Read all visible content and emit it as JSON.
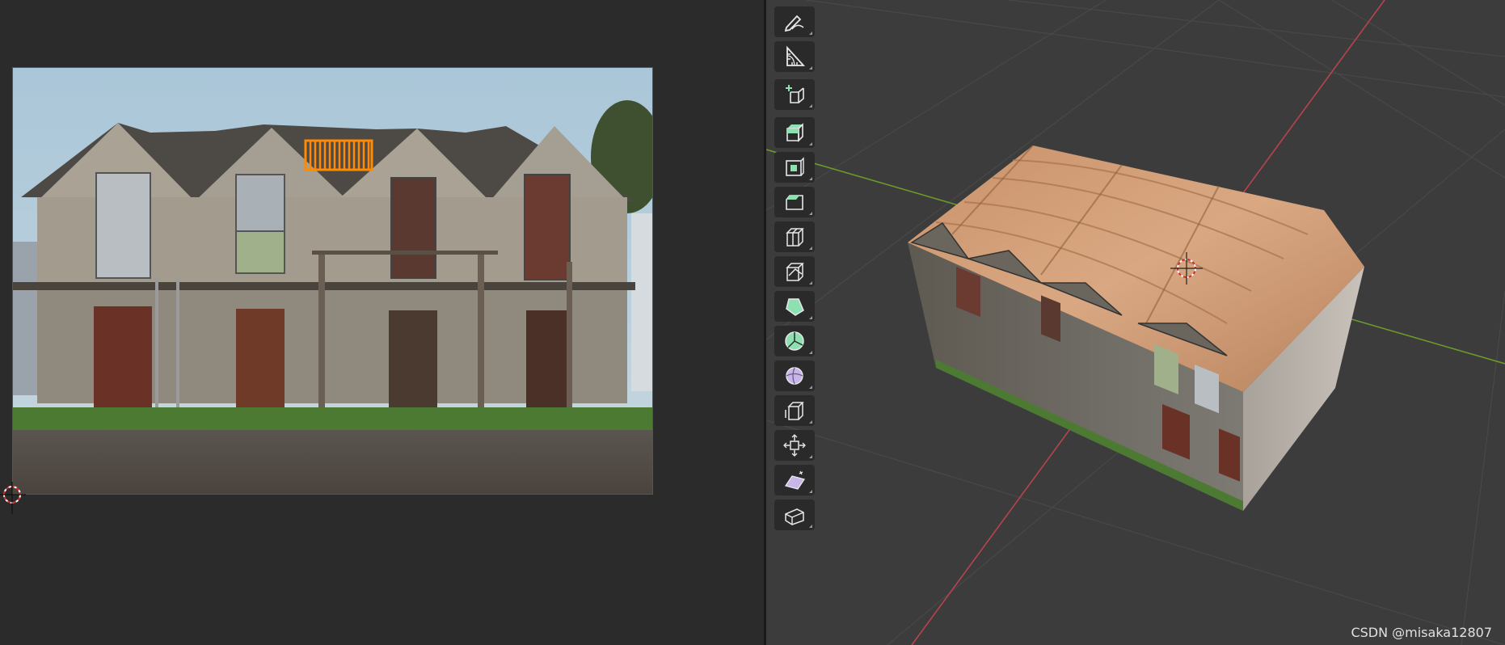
{
  "uv_editor": {
    "image_content": "weathered two-storey building with four gabled roofs",
    "selected_uv_island": "orange roof strip"
  },
  "viewport": {
    "axis_colors": {
      "x_axis": "#b8434f",
      "y_axis": "#6c9a2a"
    },
    "toolbar_tools": [
      {
        "name": "annotate-icon"
      },
      {
        "name": "measure-icon"
      },
      {
        "name": "add-cube-icon"
      },
      {
        "name": "extrude-region-icon"
      },
      {
        "name": "inset-faces-icon"
      },
      {
        "name": "bevel-icon"
      },
      {
        "name": "loop-cut-icon"
      },
      {
        "name": "knife-icon"
      },
      {
        "name": "poly-build-icon"
      },
      {
        "name": "spin-icon"
      },
      {
        "name": "smooth-icon"
      },
      {
        "name": "edge-slide-icon"
      },
      {
        "name": "shrink-fatten-icon"
      },
      {
        "name": "shear-icon"
      },
      {
        "name": "rip-region-icon"
      }
    ]
  },
  "watermark": "CSDN @misaka12807",
  "colors": {
    "accent_selection": "#ff8a00",
    "tool_active_green": "#8de0b0",
    "tool_purple": "#c9b6e8"
  }
}
